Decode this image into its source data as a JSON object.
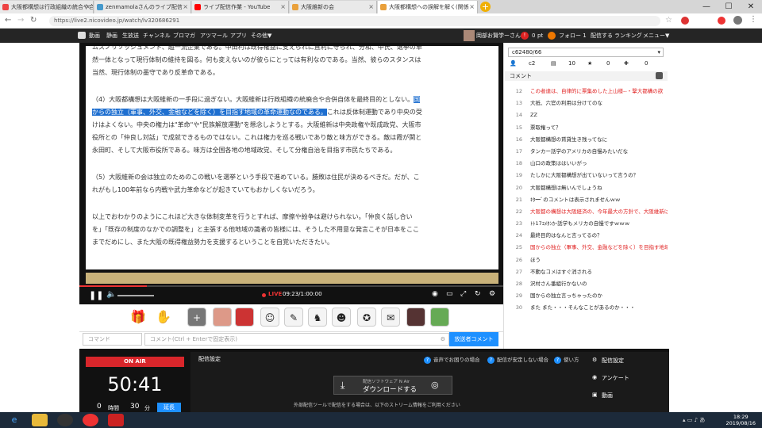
{
  "tabs": [
    {
      "label": "大阪都構想は行政組織の統合や合併自体を最終目的とはしない…",
      "active": false
    },
    {
      "label": "zenmamolaさんのライブ配信",
      "active": false
    },
    {
      "label": "ライブ配信作業 - YouTube",
      "active": false
    },
    {
      "label": "大阪維新の会",
      "active": false
    },
    {
      "label": "大阪都構想への誤解を解く(関係",
      "active": true
    }
  ],
  "url": "https://live2.nicovideo.jp/watch/lv320686291",
  "nicobar": {
    "items": [
      "動画",
      "静画",
      "生放送",
      "チャンネル",
      "ブロマガ",
      "アツマール",
      "アプリ",
      "その他▼"
    ],
    "user": "岡部お賢学ーさん",
    "points": "0",
    "pt": "pt",
    "follow": "フォロー 1",
    "broadcast": "配信する",
    "ranking": "ランキング",
    "menu": "メニュー▼"
  },
  "doc": {
    "line0": "ムスノリソッシュメント、超一流企業である。中田村は既得権益に支えられに直利に守られ、分和、中氏、選挙の単",
    "line1": "然一体となって現行体制の維持を図る。何も変えないのが彼らにとっては有利なのである。当然、彼らのスタンスは",
    "line2": "当然、現行体制の墨守であり反革命である。",
    "p4a": "（4）大阪都構想は大阪維新の一手段に過ぎない。大阪維新は行政組織の統廃合や合併自体を最終目的としない。",
    "p4hl1": "国",
    "p4hl2": "からの独立（軍事、外交、金融などを除く）を目指す地域の革命運動なのである。",
    "p4b": "これは反体制運動であり中央の受",
    "p4c": "けはよくない。中央の権力は\"革命\"や\"民族解放運動\"を懸念しようとする。大阪維新は中央政権や既成政党、大阪市",
    "p4d": "役所との「仲良し対話」で成就できるものではない。これは権力を巡る戦いであり敵と味方ができる。敵は霞が関と",
    "p4e": "永田町、そして大阪市役所である。味方は全国各地の地域政党、そして分権自治を目指す市民たちである。",
    "p5a": "（5）大阪維新の会は独立のためのこの戦いを選挙という手段で進めている。勝敗は住民が決めるべきだ。だが、こ",
    "p5b": "れがもし100年前なら内戦や武力革命などが起きていてもおかしくないだろう。",
    "p6a": "以上でおわかりのようにこれほど大きな体制変革を行うとすれば、摩擦や紛争は避けられない。「仲良く話し合い",
    "p6b": "を」「既存の制度のなかでの調整を」と主張する他地域の識者の皆様には、そうした不用意な発言こそが日本をここ",
    "p6c": "までだめにし、また大阪の既得権益勢力を支援するということを自覚いただきたい。"
  },
  "player": {
    "live": "LIVE",
    "time": "09:23/1:00:00",
    "progress": 0.16
  },
  "command_placeholder": "コマンド",
  "comment_placeholder": "コメント(Ctrl + Enterで固定表示)",
  "send_label": "放送者コメント",
  "sidebar": {
    "dropdown": "c62480/66",
    "stats": {
      "viewers": "c2",
      "comments": "10",
      "ads": "0",
      "gifts": "0"
    },
    "header": "コメント",
    "comments": [
      {
        "n": "12",
        "t": "この者達は、自律的に票集めした上山様--・撃大都構の欲",
        "red": true
      },
      {
        "n": "13",
        "t": "大抵、六官の利用は分けてのな",
        "red": false
      },
      {
        "n": "14",
        "t": "ZZ",
        "red": false
      },
      {
        "n": "15",
        "t": "票取権って？",
        "red": false
      },
      {
        "n": "16",
        "t": "大阪都構想の賃貸生き残ってなに",
        "red": false
      },
      {
        "n": "17",
        "t": "タンカー話学のアメリカの自慢みたいだな",
        "red": false
      },
      {
        "n": "18",
        "t": "山口の政策ははいいがっ",
        "red": false
      },
      {
        "n": "19",
        "t": "たしかに大阪都構想が出ていないって言うの？",
        "red": false
      },
      {
        "n": "20",
        "t": "大阪都構想は無いんでしょうね",
        "red": false
      },
      {
        "n": "21",
        "t": "ｷﾀ━ﾞのコメントは表示されませんｗｗ",
        "red": false
      },
      {
        "n": "22",
        "t": "大阪都の構想は大阪経済の、今年最大の方針で、大阪維新は外出",
        "red": true
      },
      {
        "n": "23",
        "t": "ﾄﾄ17ﾕﾒﾀﾝｶｰ話学もメリカの自慢ですｗｗｗ",
        "red": false
      },
      {
        "n": "24",
        "t": "最終目的はなんと言ってるの？",
        "red": false
      },
      {
        "n": "25",
        "t": "国からの独立（軍事、外交、金融などを除く）を目指す地域",
        "red": true
      },
      {
        "n": "26",
        "t": "ほう",
        "red": false
      },
      {
        "n": "27",
        "t": "不動なコメはすぐ消される",
        "red": false
      },
      {
        "n": "28",
        "t": "沢村さん番組行かないの",
        "red": false
      },
      {
        "n": "29",
        "t": "国からの独立言っちゃったのか",
        "red": false
      },
      {
        "n": "30",
        "t": "また また・・・そんなことがあるのか・・・",
        "red": false
      }
    ]
  },
  "broadcast": {
    "onair": "ON AIR",
    "timer": "50:41",
    "ext_hour": "0",
    "ext_hour_unit": "時間",
    "ext_min": "30",
    "ext_min_unit": "分",
    "extend": "延長",
    "settings": "配信設定",
    "help1": "音声でお困りの場合",
    "help2": "配信が安定しない場合",
    "help3": "使い方",
    "dl_small": "配信ソフトウェア N Air",
    "dl_big": "ダウンロードする",
    "note": "外部配信ツールで配信をする場合は、以下のストリーム情報をご利用ください",
    "menu": [
      "配信設定",
      "アンケート",
      "動画"
    ]
  },
  "taskbar": {
    "time": "18:29",
    "date": "2019/08/16"
  }
}
